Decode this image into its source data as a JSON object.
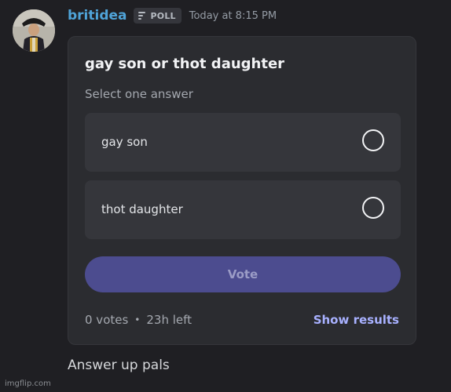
{
  "message": {
    "author": "britidea",
    "badge_label": "POLL",
    "badge_icon": "poll-bars-icon",
    "timestamp": "Today at 8:15 PM",
    "avatar_icon": "avatar-portrait-icon",
    "text": "Answer up pals"
  },
  "poll": {
    "question": "gay son or thot daughter",
    "instruction": "Select one answer",
    "answers": [
      {
        "label": "gay son",
        "selected": false
      },
      {
        "label": "thot daughter",
        "selected": false
      }
    ],
    "vote_label": "Vote",
    "votes": "0 votes",
    "separator": "•",
    "time_left": "23h left",
    "show_results_label": "Show results"
  },
  "watermark": "imgflip.com",
  "colors": {
    "background": "#1f1f23",
    "card": "#2b2c30",
    "answer_bg": "#35363b",
    "username": "#4fa3d8",
    "vote_button": "#4c4c8f",
    "link": "#a8b1ff"
  }
}
